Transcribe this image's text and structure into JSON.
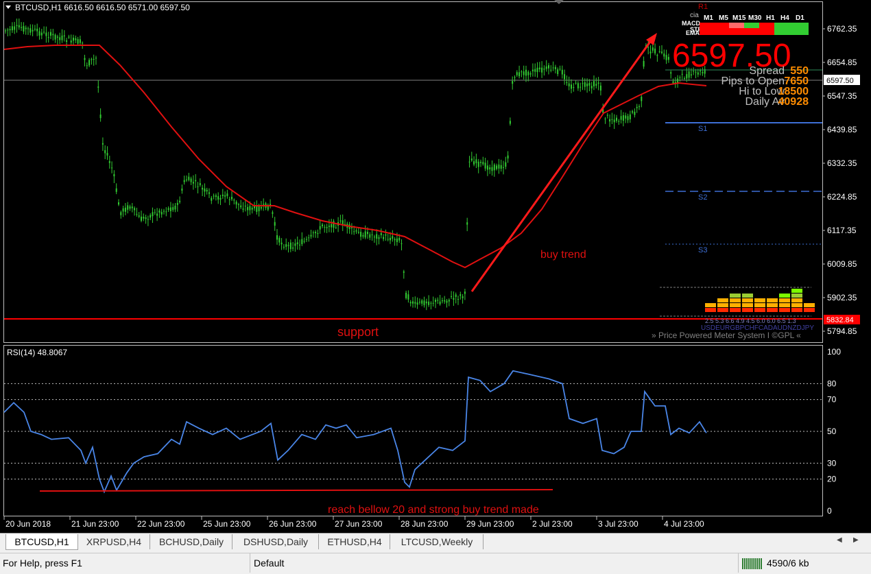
{
  "header": {
    "symbol_info": "BTCUSD,H1  6616.50 6616.50 6571.00 6597.50"
  },
  "price_axis": {
    "ticks": [
      "6762.35",
      "6654.85",
      "6547.35",
      "6439.85",
      "6332.35",
      "6224.85",
      "6117.35",
      "6009.85",
      "5902.35",
      "5794.85"
    ],
    "current_price_label": "6597.50",
    "support_price_label": "5832.84"
  },
  "time_axis": {
    "ticks": [
      "20 Jun 2018",
      "21 Jun 23:00",
      "22 Jun 23:00",
      "25 Jun 23:00",
      "26 Jun 23:00",
      "27 Jun 23:00",
      "28 Jun 23:00",
      "29 Jun 23:00",
      "2 Jul 23:00",
      "3 Jul 23:00",
      "4 Jul 23:00"
    ]
  },
  "levels": {
    "r1": "R1",
    "s1": "S1",
    "s2": "S2",
    "s3": "S3"
  },
  "annotations": {
    "support": "support",
    "buy_trend": "buy trend",
    "rsi_note": "reach bellow 20  and strong buy trend made"
  },
  "meter": {
    "big_price": "6597.50",
    "timeframes": [
      "M1",
      "M5",
      "M15",
      "M30",
      "H1",
      "H4",
      "D1"
    ],
    "side_labels": [
      "cia",
      "MACD",
      "STR",
      "EMA"
    ],
    "stats": [
      {
        "label": "Spread",
        "value": "550"
      },
      {
        "label": "Pips to Open",
        "value": "7650"
      },
      {
        "label": "Hi to Low",
        "value": "18500"
      },
      {
        "label": "Daily Av",
        "value": "40928"
      }
    ],
    "bar_numbers": "2.5 5.3 6.6 4.9 4.5 6.0 6.0 6.5 1.3",
    "currencies": "USDEURGBPCHFCADAUDNZDJPY",
    "footer": "» Price Powered Meter System I ©GPL «",
    "colors": {
      "strong": "#ff0000",
      "medium": "#ffa500",
      "weak": "#7cfc00"
    }
  },
  "rsi": {
    "title": "RSI(14) 48.8067",
    "ticks": [
      "100",
      "80",
      "70",
      "50",
      "30",
      "20",
      "0"
    ]
  },
  "tabs": [
    {
      "label": "BTCUSD,H1",
      "active": true
    },
    {
      "label": "XRPUSD,H4",
      "active": false
    },
    {
      "label": "BCHUSD,Daily",
      "active": false
    },
    {
      "label": "DSHUSD,Daily",
      "active": false
    },
    {
      "label": "ETHUSD,H4",
      "active": false
    },
    {
      "label": "LTCUSD,Weekly",
      "active": false
    }
  ],
  "status": {
    "help": "For Help, press F1",
    "profile": "Default",
    "traffic": "4590/6 kb"
  },
  "colors": {
    "candles": "#32cd32",
    "ma": "#e01010",
    "rsi": "#4a86e8",
    "background": "#000000"
  }
}
